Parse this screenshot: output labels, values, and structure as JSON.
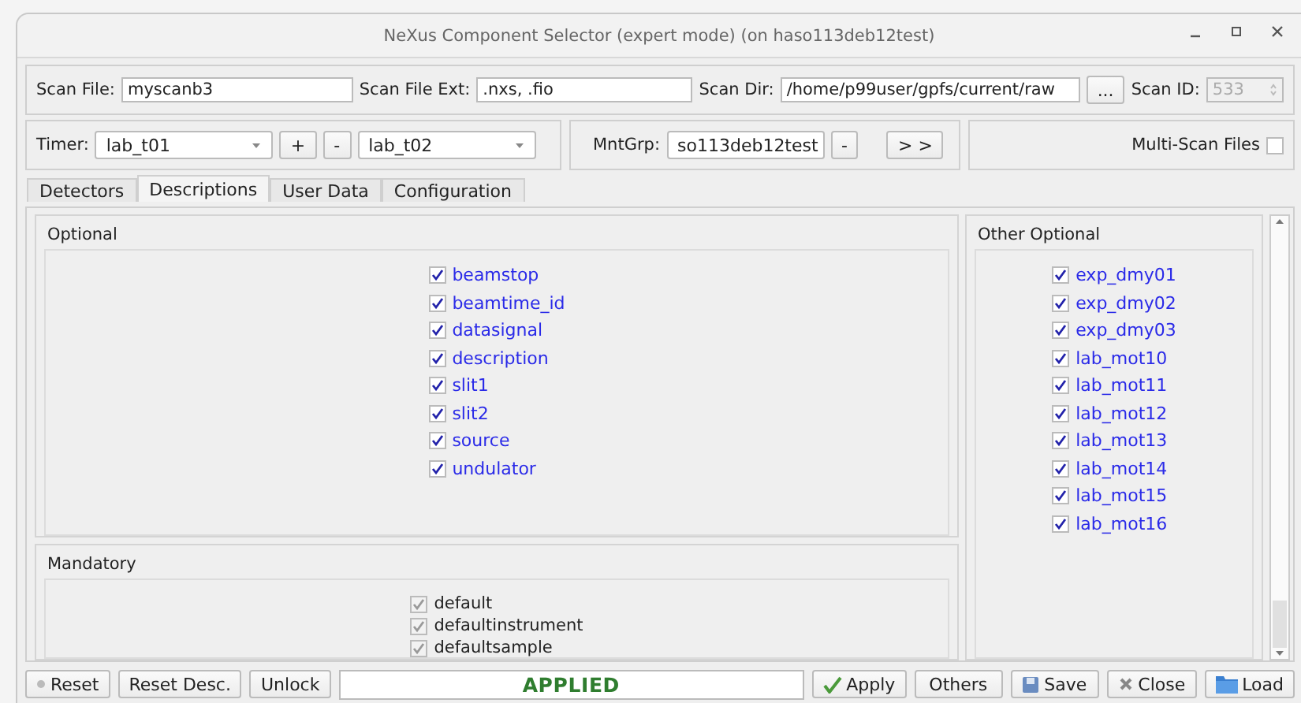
{
  "window": {
    "title": "NeXus Component Selector (expert mode) (on haso113deb12test)"
  },
  "scan": {
    "file_label": "Scan File:",
    "file": "myscanb3",
    "ext_label": "Scan File Ext:",
    "ext": ".nxs, .fio",
    "dir_label": "Scan Dir:",
    "dir": "/home/p99user/gpfs/current/raw",
    "browse": "...",
    "id_label": "Scan ID:",
    "id": "533",
    "id_disabled": true
  },
  "timer": {
    "label": "Timer:",
    "first": "lab_t01",
    "add": "+",
    "remove": "-",
    "second": "lab_t02"
  },
  "mntgrp": {
    "label": "MntGrp:",
    "value": "so113deb12test",
    "remove": "-",
    "next": "> >"
  },
  "multi_scan": {
    "label": "Multi-Scan Files",
    "checked": false
  },
  "tabs": [
    {
      "label": "Detectors",
      "selected": false
    },
    {
      "label": "Descriptions",
      "selected": true
    },
    {
      "label": "User Data",
      "selected": false
    },
    {
      "label": "Configuration",
      "selected": false
    }
  ],
  "groups": [
    {
      "title": "Optional",
      "items": [
        {
          "label": "beamstop",
          "checked": true,
          "disabled": false
        },
        {
          "label": "beamtime_id",
          "checked": true,
          "disabled": false
        },
        {
          "label": "datasignal",
          "checked": true,
          "disabled": false
        },
        {
          "label": "description",
          "checked": true,
          "disabled": false
        },
        {
          "label": "slit1",
          "checked": true,
          "disabled": false
        },
        {
          "label": "slit2",
          "checked": true,
          "disabled": false
        },
        {
          "label": "source",
          "checked": true,
          "disabled": false
        },
        {
          "label": "undulator",
          "checked": true,
          "disabled": false
        }
      ]
    },
    {
      "title": "Mandatory",
      "items": [
        {
          "label": "default",
          "checked": true,
          "disabled": true
        },
        {
          "label": "defaultinstrument",
          "checked": true,
          "disabled": true
        },
        {
          "label": "defaultsample",
          "checked": true,
          "disabled": true
        }
      ]
    },
    {
      "title": "Other Optional",
      "items": [
        {
          "label": "exp_dmy01",
          "checked": true,
          "disabled": false
        },
        {
          "label": "exp_dmy02",
          "checked": true,
          "disabled": false
        },
        {
          "label": "exp_dmy03",
          "checked": true,
          "disabled": false
        },
        {
          "label": "lab_mot10",
          "checked": true,
          "disabled": false
        },
        {
          "label": "lab_mot11",
          "checked": true,
          "disabled": false
        },
        {
          "label": "lab_mot12",
          "checked": true,
          "disabled": false
        },
        {
          "label": "lab_mot13",
          "checked": true,
          "disabled": false
        },
        {
          "label": "lab_mot14",
          "checked": true,
          "disabled": false
        },
        {
          "label": "lab_mot15",
          "checked": true,
          "disabled": false
        },
        {
          "label": "lab_mot16",
          "checked": true,
          "disabled": false
        }
      ]
    }
  ],
  "buttons": [
    {
      "label": "Reset"
    },
    {
      "label": "Reset Desc."
    },
    {
      "label": "Unlock"
    }
  ],
  "status": "APPLIED",
  "actions": [
    {
      "label": "Apply"
    },
    {
      "label": "Others"
    },
    {
      "label": "Save"
    },
    {
      "label": "Close"
    },
    {
      "label": "Load"
    }
  ]
}
